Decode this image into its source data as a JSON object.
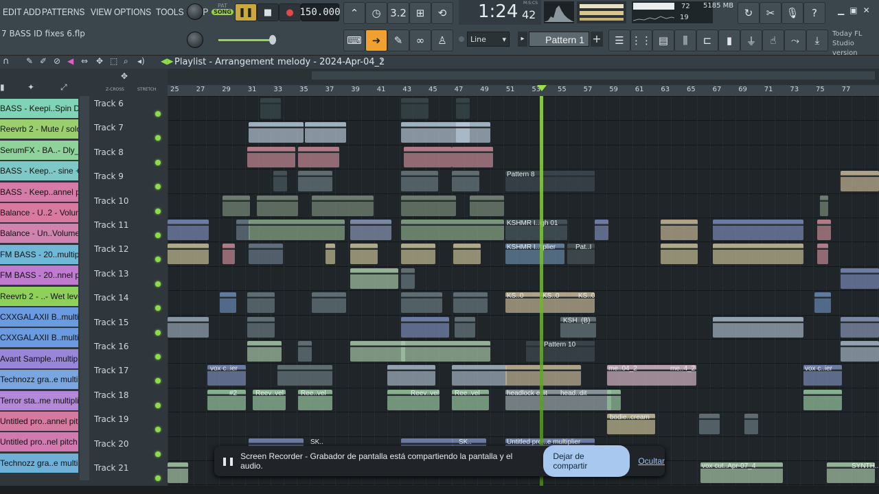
{
  "menu": [
    "EDIT",
    "ADD",
    "PATTERNS",
    "VIEW",
    "OPTIONS",
    "TOOLS",
    "HELP"
  ],
  "transport": {
    "pat_label": "PAT",
    "song_label": "SONG",
    "tempo": "150.000",
    "time": "1:24",
    "time_sub": "42",
    "time_unit": "M:S:CS"
  },
  "cpu": {
    "mem": "5185 MB",
    "voices": "19",
    "cpu_val": "72"
  },
  "pattern": {
    "snap": "Line",
    "name": "Pattern 1"
  },
  "today": {
    "line1": "Today  FL",
    "line2": "Studio version"
  },
  "file": {
    "name": "7 BASS ID fixes 6.flp"
  },
  "playlist": {
    "title": "Playlist - Arrangement",
    "sep": "›",
    "name": "melody - 2024-Apr-04_2"
  },
  "ruler": {
    "zcross": "Z-CROSS",
    "stretch": "STRETCH",
    "bars": [
      "25",
      "27",
      "29",
      "31",
      "33",
      "35",
      "37",
      "39",
      "41",
      "43",
      "45",
      "47",
      "49",
      "51",
      "53",
      "55",
      "57",
      "59",
      "61",
      "63",
      "65",
      "67",
      "69",
      "71",
      "73",
      "75",
      "77"
    ]
  },
  "channels": [
    {
      "label": "BASS - Keepi..Spin Depth",
      "color": "#7fd4b8"
    },
    {
      "label": "Reevrb 2 - Mute / solo",
      "color": "#9bcf6e"
    },
    {
      "label": "SerumFX - BA..- Dly_Wet",
      "color": "#8fd39a"
    },
    {
      "label": "BASS - Keep..- sine + FM",
      "color": "#7fc8c8"
    },
    {
      "label": "BASS - Keep..annel pitch",
      "color": "#d67aa8"
    },
    {
      "label": "Balance - U..2 - Volume",
      "color": "#d87aa0"
    },
    {
      "label": "Balance - Un..Volume #2",
      "color": "#cf84b0"
    },
    {
      "label": "FM BASS - 20..multiplier",
      "color": "#6fb8d8"
    },
    {
      "label": "FM BASS - 20..nnel pitch",
      "color": "#c07ad0"
    },
    {
      "label": "Reevrb 2 - ..- Wet level",
      "color": "#8fd05a"
    },
    {
      "label": "CXXGALAXII B..multiplier",
      "color": "#6a9be0"
    },
    {
      "label": "CXXGALAXII B..multiplier",
      "color": "#6a9be0"
    },
    {
      "label": "Avant Sample..multiplier",
      "color": "#9a86d8"
    },
    {
      "label": "Technozz gra..e multiplier",
      "color": "#7aa6e0"
    },
    {
      "label": "Terror sta..me multiplier",
      "color": "#b488d8"
    },
    {
      "label": "Untitled pro..annel pitch",
      "color": "#d47aa0"
    },
    {
      "label": "Untitled pro..nel pitch #2",
      "color": "#d07ab0"
    },
    {
      "label": "Technozz gra..e multiplier",
      "color": "#6fb0d8"
    }
  ],
  "tracks": [
    "Track 6",
    "Track 7",
    "Track 8",
    "Track 9",
    "Track 10",
    "Track 11",
    "Track 12",
    "Track 13",
    "Track 14",
    "Track 15",
    "Track 16",
    "Track 17",
    "Track 18",
    "Track 19",
    "Track 20",
    "Track 21"
  ],
  "clip_labels": [
    {
      "text": "Pattern 8"
    },
    {
      "text": "KSHMR I..igh 01"
    },
    {
      "text": "KSHMR I..tiplier"
    },
    {
      "text": "Pat..I"
    },
    {
      "text": "KS..0"
    },
    {
      "text": "KS..0"
    },
    {
      "text": "KS..0"
    },
    {
      "text": "KSH..(B)"
    },
    {
      "text": "Pattern 10"
    },
    {
      "text": "vox c..ier"
    },
    {
      "text": "me..04_2"
    },
    {
      "text": "me..4_2"
    },
    {
      "text": "vox c..ier"
    },
    {
      "text": "#2"
    },
    {
      "text": "Reev..vel"
    },
    {
      "text": "Ree..vel"
    },
    {
      "text": "Reev..vel"
    },
    {
      "text": "Ree..vel"
    },
    {
      "text": "headlock edit"
    },
    {
      "text": "head..dit"
    },
    {
      "text": "bodie..cream"
    },
    {
      "text": "SK.."
    },
    {
      "text": "SK.."
    },
    {
      "text": "Untitled proj..e multiplier"
    },
    {
      "text": "vox cut..Apr-07_4"
    },
    {
      "text": "SYNTH.."
    }
  ],
  "notification": {
    "text": "Screen Recorder - Grabador de pantalla está compartiendo la pantalla y el audio.",
    "stop": "Dejar de compartir",
    "hide": "Ocultar"
  }
}
